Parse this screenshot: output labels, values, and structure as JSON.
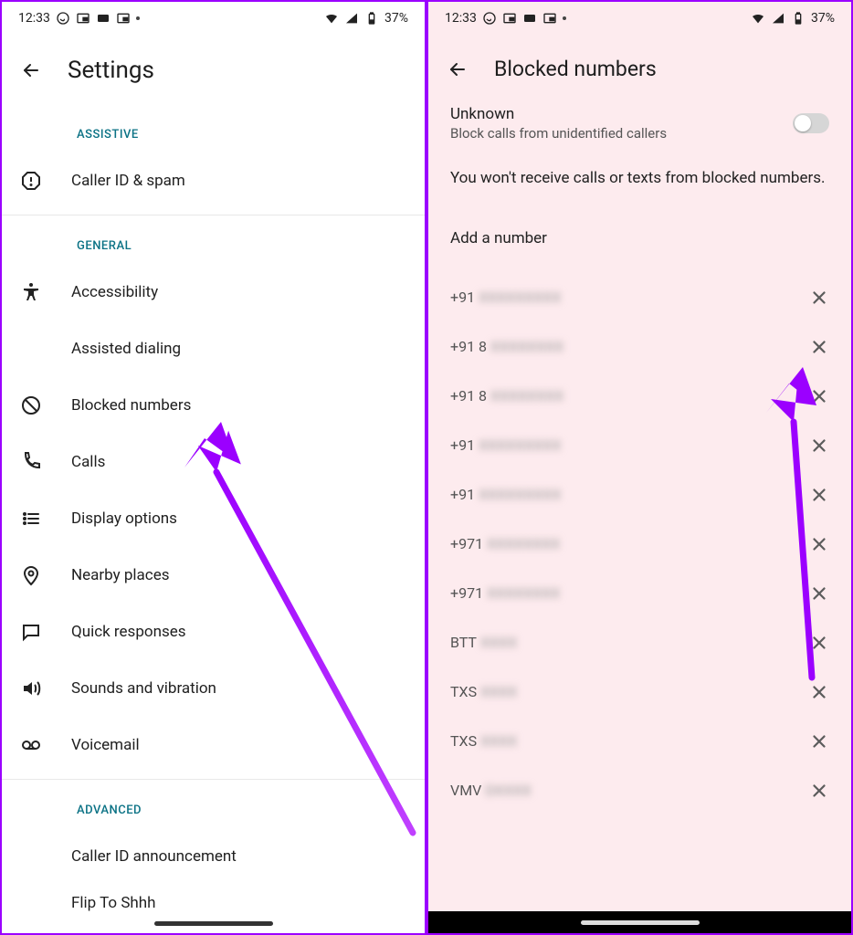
{
  "status": {
    "time": "12:33",
    "battery": "37%"
  },
  "left": {
    "title": "Settings",
    "sections": {
      "assistive": {
        "header": "ASSISTIVE"
      },
      "general": {
        "header": "GENERAL"
      },
      "advanced": {
        "header": "ADVANCED"
      }
    },
    "items": {
      "callerIdSpam": "Caller ID & spam",
      "accessibility": "Accessibility",
      "assistedDialing": "Assisted dialing",
      "blockedNumbers": "Blocked numbers",
      "calls": "Calls",
      "displayOptions": "Display options",
      "nearbyPlaces": "Nearby places",
      "quickResponses": "Quick responses",
      "soundsVibration": "Sounds and vibration",
      "voicemail": "Voicemail",
      "callerIdAnn": "Caller ID announcement",
      "flipToShhh": "Flip To Shhh"
    }
  },
  "right": {
    "title": "Blocked numbers",
    "toggle": {
      "title": "Unknown",
      "subtitle": "Block calls from unidentified callers"
    },
    "info": "You won't receive calls or texts from blocked numbers.",
    "addNumber": "Add a number",
    "rows": [
      {
        "prefix": "+91",
        "rest": "XXXXXXXXX"
      },
      {
        "prefix": "+91 8",
        "rest": "XXXXXXXX"
      },
      {
        "prefix": "+91 8",
        "rest": "XXXXXXXX"
      },
      {
        "prefix": "+91",
        "rest": "XXXXXXXXX"
      },
      {
        "prefix": "+91",
        "rest": "XXXXXXXXX"
      },
      {
        "prefix": "+971",
        "rest": "XXXXXXXX"
      },
      {
        "prefix": "+971",
        "rest": "XXXXXXXX"
      },
      {
        "prefix": "BTT",
        "rest": "XXXX"
      },
      {
        "prefix": "TXS",
        "rest": "XXXX"
      },
      {
        "prefix": "TXS",
        "rest": "XXXX"
      },
      {
        "prefix": "VMV",
        "rest": "DXXXX"
      }
    ]
  }
}
